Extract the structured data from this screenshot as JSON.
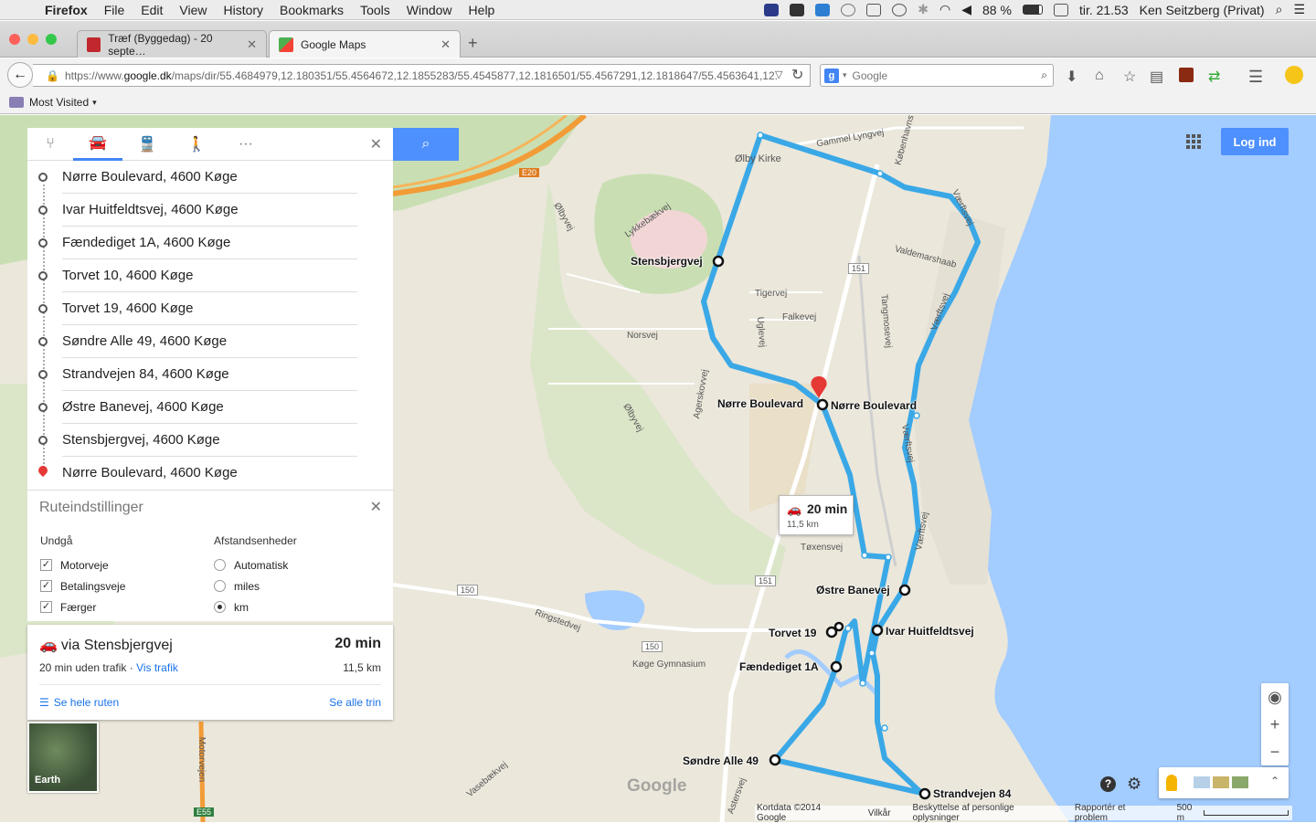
{
  "menubar": {
    "app": "Firefox",
    "items": [
      "File",
      "Edit",
      "View",
      "History",
      "Bookmarks",
      "Tools",
      "Window",
      "Help"
    ],
    "battery": "88 %",
    "clock": "tir. 21.53",
    "user": "Ken Seitzberg (Privat)"
  },
  "tabs": [
    {
      "title": "Træf (Byggedag) - 20 septe…",
      "active": false
    },
    {
      "title": "Google Maps",
      "active": true
    }
  ],
  "nav": {
    "url_prefix": "https://www.",
    "url_domain": "google.dk",
    "url_rest": "/maps/dir/55.4684979,12.180351/55.4564672,12.1855283/55.4545877,12.1816501/55.4567291,12.1818647/55.4563641,12.",
    "search_placeholder": "Google"
  },
  "bookmarks": {
    "most_visited": "Most Visited"
  },
  "directions": {
    "waypoints": [
      "Nørre Boulevard, 4600 Køge",
      "Ivar Huitfeldtsvej, 4600 Køge",
      "Fændediget 1A, 4600 Køge",
      "Torvet 10, 4600 Køge",
      "Torvet 19, 4600 Køge",
      "Søndre Alle 49, 4600 Køge",
      "Strandvejen 84, 4600 Køge",
      "Østre Banevej, 4600 Køge",
      "Stensbjergvej, 4600 Køge",
      "Nørre Boulevard, 4600 Køge"
    ],
    "options_title": "Ruteindstillinger",
    "avoid_title": "Undgå",
    "avoid": [
      {
        "label": "Motorveje",
        "checked": true
      },
      {
        "label": "Betalingsveje",
        "checked": true
      },
      {
        "label": "Færger",
        "checked": true
      }
    ],
    "units_title": "Afstandsenheder",
    "units": [
      {
        "label": "Automatisk",
        "selected": false
      },
      {
        "label": "miles",
        "selected": false
      },
      {
        "label": "km",
        "selected": true
      }
    ],
    "route": {
      "via": "via Stensbjergvej",
      "duration": "20 min",
      "traffic_note": "20 min uden trafik · ",
      "traffic_link": "Vis trafik",
      "distance": "11,5 km",
      "full_route": "Se hele ruten",
      "all_steps": "Se alle trin"
    }
  },
  "map": {
    "earth_label": "Earth",
    "login": "Log ind",
    "eta_time": "20 min",
    "eta_dist": "11,5 km",
    "google_logo": "Google",
    "footer": [
      "Kortdata ©2014 Google",
      "Vilkår",
      "Beskyttelse af personlige oplysninger",
      "Rapportér et problem"
    ],
    "scale": "500 m",
    "route_color": "#3aa8e6",
    "water_color": "#a3ccff",
    "labels": {
      "gammel_lyngvej": "Gammel Lyngvej",
      "kobenhavns": "Københavns",
      "olby_kirke": "Ølby Kirke",
      "lykkebaekvej": "Lykkebækvej",
      "olbyvej": "Ølbyvej",
      "valdemarshaab": "Valdemarshaab",
      "vaerftsvej": "Værftsvej",
      "tigervej": "Tigervej",
      "falkevej": "Falkevej",
      "uglevej": "Uglevej",
      "tangmosevej": "Tangmosevej",
      "norsvej": "Norsvej",
      "agerskovvej": "Agerskovvej",
      "toxensvej": "Tøxensvej",
      "ringstedvej": "Ringstedvej",
      "koge_gymnasium": "Køge Gymnasium",
      "motorvejen": "Motorvejen",
      "vasebaekvej": "Vasebækvej",
      "astersvej": "Astersvej",
      "e20": "E20",
      "e55": "E55",
      "r151a": "151",
      "r151b": "151",
      "r150a": "150",
      "r150b": "150"
    },
    "waypoint_labels": {
      "stensbjergvej": "Stensbjergvej",
      "norre_bvd_left": "Nørre Boulevard",
      "norre_bvd_right": "Nørre Boulevard",
      "ostre_banevej": "Østre Banevej",
      "torvet19": "Torvet 19",
      "ivar": "Ivar Huitfeldtsvej",
      "faendediget": "Fændediget 1A",
      "sondre": "Søndre Alle 49",
      "strandvejen": "Strandvejen 84"
    }
  }
}
